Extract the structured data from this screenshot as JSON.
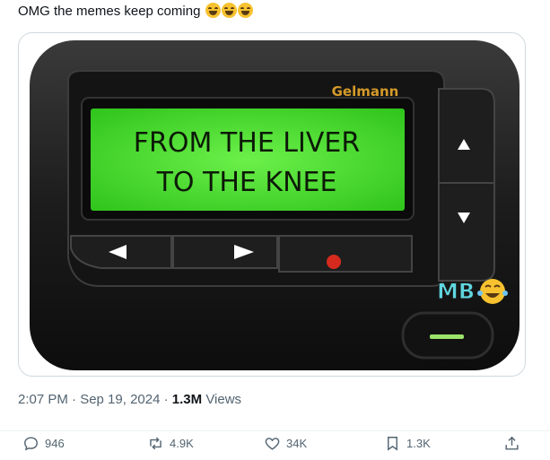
{
  "tweet": {
    "text": "OMG the memes keep coming",
    "emojis": [
      "joy-emoji",
      "joy-emoji",
      "joy-emoji"
    ]
  },
  "image": {
    "brand": "Gelmann",
    "screen_line1": "FROM THE LIVER",
    "screen_line2": "TO THE KNEE",
    "watermark": "MB",
    "colors": {
      "screen": "#3fdc2a",
      "body": "#1a1a1a",
      "button_dot": "#d62a1e",
      "light_bar": "#9be36a"
    }
  },
  "meta": {
    "timestamp": "2:07 PM · Sep 19, 2024",
    "separator": "·",
    "views_count": "1.3M",
    "views_label": "Views"
  },
  "actions": {
    "replies": "946",
    "reposts": "4.9K",
    "likes": "34K",
    "bookmarks": "1.3K"
  }
}
